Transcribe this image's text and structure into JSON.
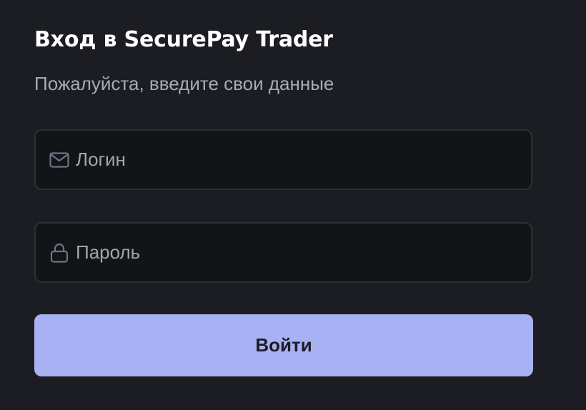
{
  "header": {
    "title_prefix": "Вход в ",
    "title_brand": "SecurePay Trader",
    "subtitle": "Пожалуйста, введите свои данные"
  },
  "form": {
    "login": {
      "icon": "mail-icon",
      "value": "",
      "placeholder": "Логин"
    },
    "password": {
      "icon": "lock-icon",
      "value": "",
      "placeholder": "Пароль"
    },
    "submit_label": "Войти"
  },
  "colors": {
    "background": "#1b1d22",
    "field_background": "#121417",
    "field_border": "#2c2f35",
    "icon": "#6d7585",
    "placeholder": "#a3a6ad",
    "title": "#ffffff",
    "subtitle": "#a9abb3",
    "button_background": "#a9b1f5",
    "button_text": "#1b1d24"
  }
}
